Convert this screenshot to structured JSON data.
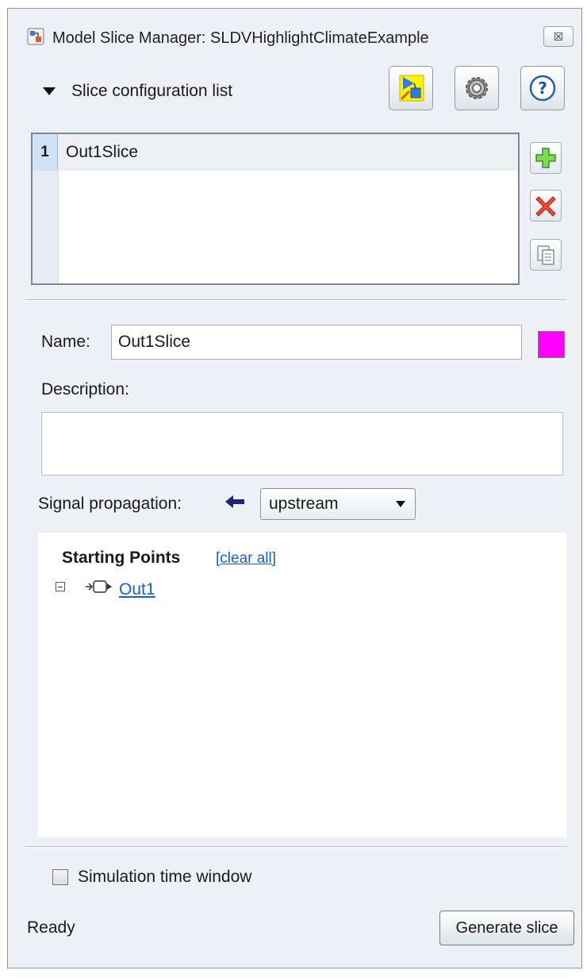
{
  "window": {
    "title": "Model Slice Manager: SLDVHighlightClimateExample",
    "close_glyph": "☒"
  },
  "slice_config": {
    "section_label": "Slice configuration list",
    "items": [
      {
        "number": "1",
        "label": "Out1Slice"
      }
    ]
  },
  "toolbar": {
    "icons": [
      "highlight-slice-icon",
      "gear-icon",
      "help-icon"
    ],
    "help_glyph": "?"
  },
  "list_actions": {
    "icons": [
      "add-icon",
      "delete-icon",
      "copy-icon"
    ]
  },
  "form": {
    "name_label": "Name:",
    "name_value": "Out1Slice",
    "highlight_color": "#ff00ff",
    "description_label": "Description:",
    "description_value": "",
    "signal_propagation_label": "Signal propagation:",
    "signal_propagation_value": "upstream"
  },
  "starting_points": {
    "title": "Starting Points",
    "clear_all": "[clear all]",
    "items": [
      {
        "label": "Out1 "
      }
    ]
  },
  "simulation_window": {
    "label": "Simulation time window",
    "checked": false
  },
  "status": {
    "text": "Ready"
  },
  "actions": {
    "generate_label": "Generate slice"
  }
}
